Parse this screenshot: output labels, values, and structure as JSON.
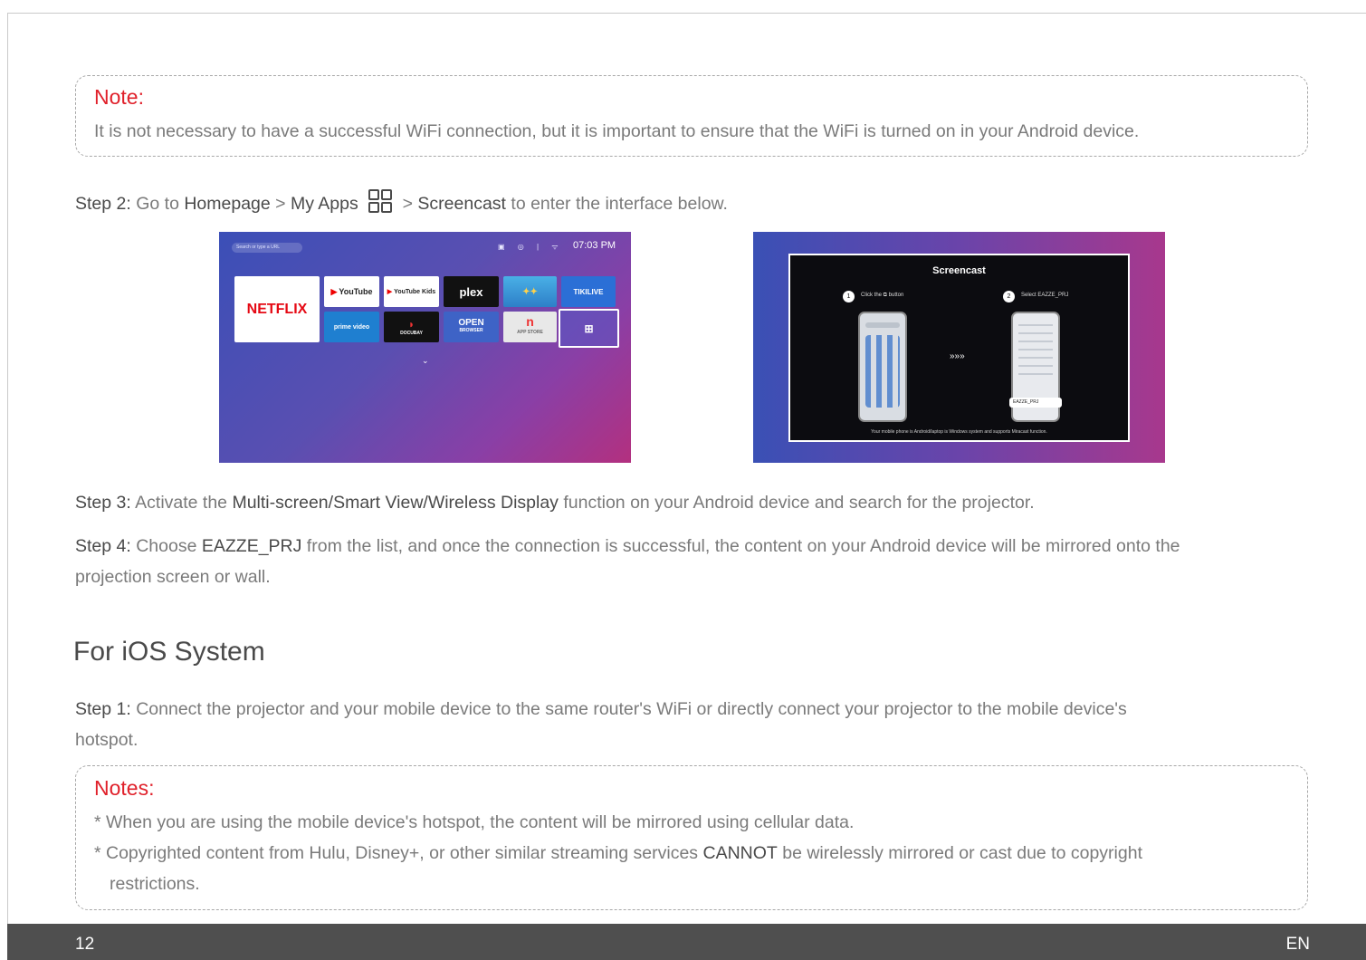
{
  "note": {
    "title": "Note:",
    "text": "It is not necessary to have a successful WiFi connection, but it is important to ensure that the WiFi is turned on in your Android device."
  },
  "step2": {
    "label": "Step 2:",
    "t1": " Go to ",
    "homepage": "Homepage",
    "t2": " > ",
    "my_apps": "My Apps",
    "t3": " > ",
    "screencast": "Screencast",
    "t4": " to enter the interface below."
  },
  "screen1": {
    "search_placeholder": "Search or type a URL",
    "time": "07:03 PM",
    "tiles": [
      "NETFLIX",
      "YouTube",
      "YouTube Kids",
      "plex",
      "TIKILIVE",
      "prime video",
      "DOCUBAY",
      "OPEN",
      "BROWSER",
      "n",
      "APP STORE"
    ]
  },
  "screen2": {
    "title": "Screencast",
    "step1_num": "1",
    "step1_text": "Click the",
    "step1_text2": "button",
    "step2_num": "2",
    "step2_text": "Select EAZZE_PRJ",
    "arrows": "»»»",
    "device_name": "EAZZE_PRJ",
    "footer": "Your mobile phone is Android/laptop is Windows system and supports Miracast function."
  },
  "step3": {
    "label": "Step 3:",
    "t1": " Activate the ",
    "feature": "Multi-screen/Smart View/Wireless Display",
    "t2": " function on your Android device and search for the projector."
  },
  "step4": {
    "label": "Step 4:",
    "t1": " Choose ",
    "device": "EAZZE_PRJ",
    "t2": " from the list, and once the connection is successful, the content on your Android device will be mirrored onto the",
    "line2": "projection screen or wall."
  },
  "ios": {
    "heading": "For iOS System",
    "step1_label": "Step 1:",
    "step1_text": " Connect the projector and your mobile device to the same router's WiFi or directly connect your projector to the mobile device's",
    "step1_line2": "hotspot."
  },
  "notes": {
    "title": "Notes:",
    "item1": "* When you are using the mobile device's hotspot, the content will be mirrored using cellular data.",
    "item2_a": "* Copyrighted content from Hulu, Disney+, or other similar streaming services ",
    "item2_strong": "CANNOT",
    "item2_b": " be wirelessly mirrored or cast due to copyright",
    "item2_line2": "restrictions."
  },
  "footer": {
    "page_number": "12",
    "language": "EN"
  }
}
